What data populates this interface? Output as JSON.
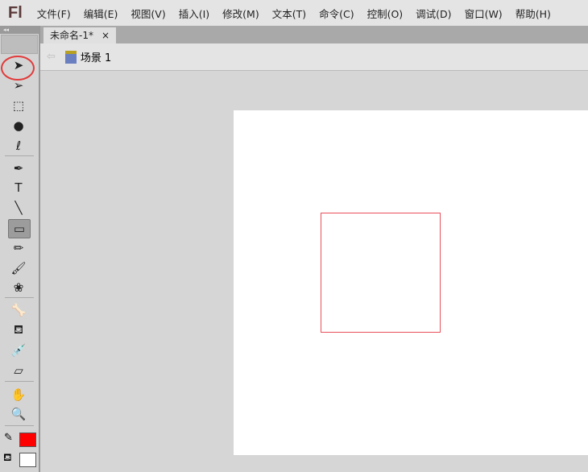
{
  "app": {
    "logo": "Fl"
  },
  "menu": [
    "文件(F)",
    "编辑(E)",
    "视图(V)",
    "插入(I)",
    "修改(M)",
    "文本(T)",
    "命令(C)",
    "控制(O)",
    "调试(D)",
    "窗口(W)",
    "帮助(H)"
  ],
  "document": {
    "tab_label": "未命名-1*",
    "close": "×",
    "scene": "场景 1"
  },
  "toolbar": {
    "collapse": "◂◂",
    "selected_tool": "rectangle-tool",
    "tools": [
      {
        "name": "selection-tool",
        "glyph": "➤"
      },
      {
        "name": "subselection-tool",
        "glyph": "➢"
      },
      {
        "name": "free-transform-tool",
        "glyph": "⬚"
      },
      {
        "name": "3d-rotation-tool",
        "glyph": "●"
      },
      {
        "name": "lasso-tool",
        "glyph": "ℓ"
      },
      {
        "name": "pen-tool",
        "glyph": "✒"
      },
      {
        "name": "text-tool",
        "glyph": "T"
      },
      {
        "name": "line-tool",
        "glyph": "╲"
      },
      {
        "name": "rectangle-tool",
        "glyph": "▭"
      },
      {
        "name": "pencil-tool",
        "glyph": "✏"
      },
      {
        "name": "brush-tool",
        "glyph": "🖌"
      },
      {
        "name": "deco-tool",
        "glyph": "❀"
      },
      {
        "name": "bone-tool",
        "glyph": "🦴"
      },
      {
        "name": "paint-bucket-tool",
        "glyph": "⛾"
      },
      {
        "name": "eyedropper-tool",
        "glyph": "💉"
      },
      {
        "name": "eraser-tool",
        "glyph": "▱"
      },
      {
        "name": "hand-tool",
        "glyph": "✋"
      },
      {
        "name": "zoom-tool",
        "glyph": "🔍"
      }
    ]
  },
  "colors": {
    "stroke": "#ff0000",
    "fill": "#ffffff",
    "shape_stroke": "#e8505a",
    "highlight_circle": "#e23a3a"
  }
}
